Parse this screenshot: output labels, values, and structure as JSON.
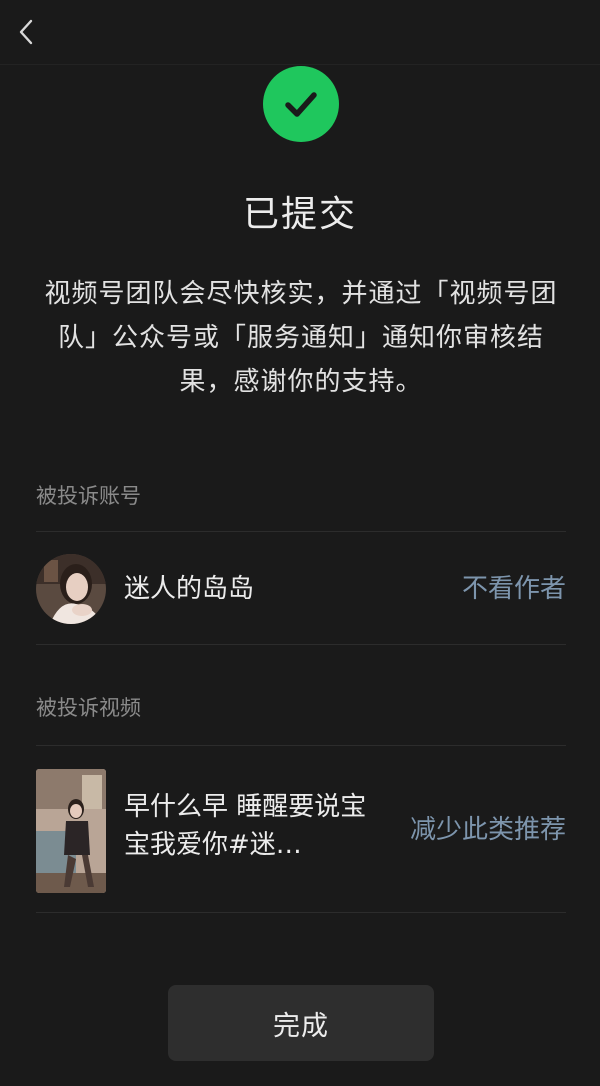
{
  "header": {
    "back_icon": "chevron-left-icon"
  },
  "status": {
    "icon": "check-circle-icon",
    "color": "#1fc75d",
    "title": "已提交",
    "description": "视频号团队会尽快核实，并通过「视频号团队」公众号或「服务通知」通知你审核结果，感谢你的支持。"
  },
  "reported_account": {
    "section_label": "被投诉账号",
    "name": "迷人的岛岛",
    "action_label": "不看作者"
  },
  "reported_video": {
    "section_label": "被投诉视频",
    "title": "早什么早 睡醒要说宝宝我爱你#迷…",
    "action_label": "减少此类推荐"
  },
  "footer": {
    "done_label": "完成"
  },
  "colors": {
    "background": "#1a1a1a",
    "accent_link": "#7d95ad",
    "success": "#1fc75d"
  }
}
